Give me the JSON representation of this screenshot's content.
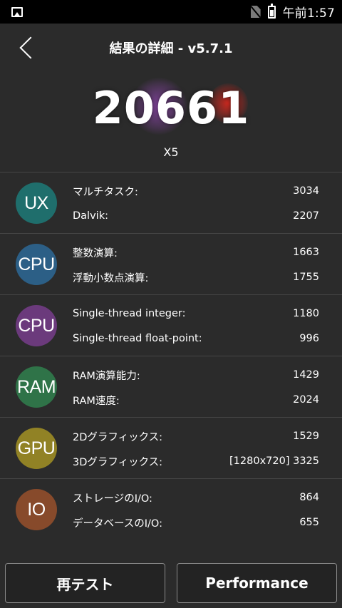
{
  "status_bar": {
    "time": "午前1:57"
  },
  "header": {
    "title": "結果の詳細 - v5.7.1"
  },
  "score": {
    "value": "20661",
    "device": "X5"
  },
  "categories": [
    {
      "label": "UX",
      "color": "#1f6e6c",
      "lines": [
        {
          "name": "マルチタスク:",
          "value": "3034"
        },
        {
          "name": "Dalvik:",
          "value": "2207"
        }
      ]
    },
    {
      "label": "CPU",
      "color": "#2c5f86",
      "lines": [
        {
          "name": "整数演算:",
          "value": "1663"
        },
        {
          "name": "浮動小数点演算:",
          "value": "1755"
        }
      ]
    },
    {
      "label": "CPU",
      "color": "#6b3a7c",
      "lines": [
        {
          "name": "Single-thread integer:",
          "value": "1180"
        },
        {
          "name": "Single-thread float-point:",
          "value": "996"
        }
      ]
    },
    {
      "label": "RAM",
      "color": "#2f7348",
      "lines": [
        {
          "name": "RAM演算能力:",
          "value": "1429"
        },
        {
          "name": "RAM速度:",
          "value": "2024"
        }
      ]
    },
    {
      "label": "GPU",
      "color": "#918225",
      "lines": [
        {
          "name": "2Dグラフィックス:",
          "value": "1529"
        },
        {
          "name": "3Dグラフィックス:",
          "value": "[1280x720] 3325"
        }
      ]
    },
    {
      "label": "IO",
      "color": "#874a2b",
      "lines": [
        {
          "name": "ストレージのI/O:",
          "value": "864"
        },
        {
          "name": "データベースのI/O:",
          "value": "655"
        }
      ]
    }
  ],
  "buttons": {
    "retest": "再テスト",
    "performance": "Performance"
  },
  "icons": {
    "status_left": "gallery-icon",
    "status_nosim": "no-sim-icon",
    "status_battery": "battery-icon",
    "back": "back-arrow-icon"
  }
}
